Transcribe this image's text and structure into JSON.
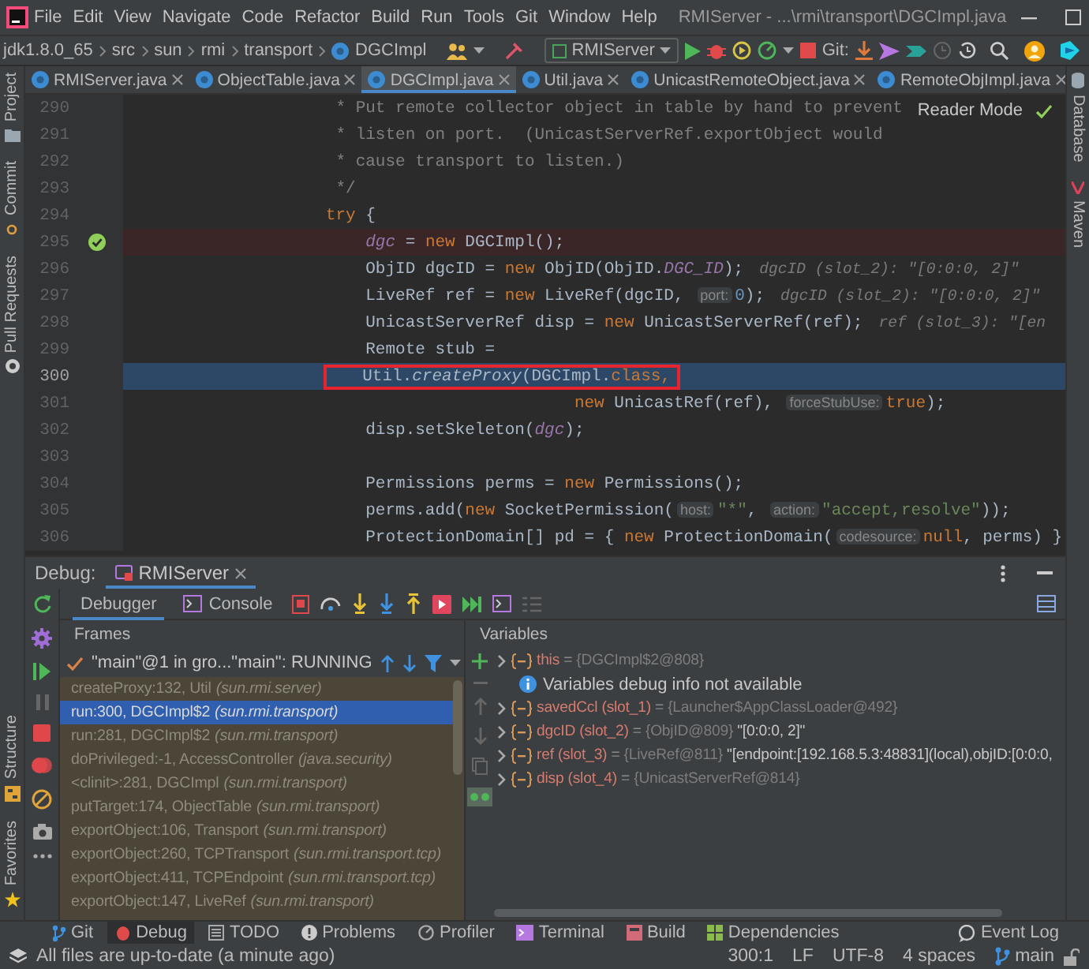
{
  "menu_bar": {
    "items": [
      "File",
      "Edit",
      "View",
      "Navigate",
      "Code",
      "Refactor",
      "Build",
      "Run",
      "Tools",
      "Git",
      "Window",
      "Help"
    ],
    "title": "RMIServer - ...\\rmi\\transport\\DGCImpl.java"
  },
  "nav_bar": {
    "breadcrumb": [
      "jdk1.8.0_65",
      "src",
      "sun",
      "rmi",
      "transport",
      "DGCImpl"
    ],
    "run_config": "RMIServer",
    "git_label": "Git:"
  },
  "editor_tabs": [
    {
      "label": "RMIServer.java",
      "selected": false
    },
    {
      "label": "ObjectTable.java",
      "selected": false
    },
    {
      "label": "DGCImpl.java",
      "selected": true
    },
    {
      "label": "Util.java",
      "selected": false
    },
    {
      "label": "UnicastRemoteObject.java",
      "selected": false
    },
    {
      "label": "RemoteObjImpl.java",
      "selected": false
    }
  ],
  "left_tool_strip": {
    "top": [
      "Project",
      "Commit",
      "Pull Requests"
    ],
    "bottom": [
      "Structure",
      "Favorites"
    ]
  },
  "right_tool_strip": [
    "Database",
    "Maven"
  ],
  "editor": {
    "reader_mode": "Reader Mode",
    "lines": [
      {
        "number": "290",
        "breakpoint": false,
        "current": false,
        "annotated": false,
        "tokens": [
          {
            "kind": "comment",
            "text": "         * Put remote collector object in table by hand to prevent"
          }
        ]
      },
      {
        "number": "291",
        "breakpoint": false,
        "current": false,
        "annotated": false,
        "tokens": [
          {
            "kind": "comment",
            "text": "         * listen on port.  (UnicastServerRef.exportObject would"
          }
        ]
      },
      {
        "number": "292",
        "breakpoint": false,
        "current": false,
        "annotated": false,
        "tokens": [
          {
            "kind": "comment",
            "text": "         * cause transport to listen.)"
          }
        ]
      },
      {
        "number": "293",
        "breakpoint": false,
        "current": false,
        "annotated": false,
        "tokens": [
          {
            "kind": "comment",
            "text": "         */"
          }
        ]
      },
      {
        "number": "294",
        "breakpoint": false,
        "current": false,
        "annotated": false,
        "tokens": [
          {
            "kind": "kw",
            "text": "        try"
          },
          {
            "kind": "plain",
            "text": " {"
          }
        ]
      },
      {
        "number": "295",
        "breakpoint": true,
        "current": false,
        "annotated": false,
        "tokens": [
          {
            "kind": "field",
            "text": "            dgc"
          },
          {
            "kind": "plain",
            "text": " = "
          },
          {
            "kind": "kw",
            "text": "new"
          },
          {
            "kind": "plain",
            "text": " DGCImpl();"
          }
        ]
      },
      {
        "number": "296",
        "breakpoint": false,
        "current": false,
        "annotated": false,
        "tokens": [
          {
            "kind": "plain",
            "text": "            ObjID dgcID = "
          },
          {
            "kind": "kw",
            "text": "new"
          },
          {
            "kind": "plain",
            "text": " ObjID(ObjID."
          },
          {
            "kind": "static",
            "text": "DGC_ID"
          },
          {
            "kind": "plain",
            "text": ");"
          },
          {
            "kind": "inline",
            "text": "dgcID (slot_2): \"[0:0:0, 2]\""
          }
        ]
      },
      {
        "number": "297",
        "breakpoint": false,
        "current": false,
        "annotated": false,
        "tokens": [
          {
            "kind": "plain",
            "text": "            LiveRef ref = "
          },
          {
            "kind": "kw",
            "text": "new"
          },
          {
            "kind": "plain",
            "text": " LiveRef(dgcID, "
          },
          {
            "kind": "hint",
            "text": "port:"
          },
          {
            "kind": "num",
            "text": "0"
          },
          {
            "kind": "plain",
            "text": ");"
          },
          {
            "kind": "inline",
            "text": "dgcID (slot_2): \"[0:0:0, 2]\""
          }
        ]
      },
      {
        "number": "298",
        "breakpoint": false,
        "current": false,
        "annotated": false,
        "tokens": [
          {
            "kind": "plain",
            "text": "            UnicastServerRef disp = "
          },
          {
            "kind": "kw",
            "text": "new"
          },
          {
            "kind": "plain",
            "text": " UnicastServerRef(ref);"
          },
          {
            "kind": "inline",
            "text": "ref (slot_3): \"[en"
          }
        ]
      },
      {
        "number": "299",
        "breakpoint": false,
        "current": false,
        "annotated": false,
        "tokens": [
          {
            "kind": "plain",
            "text": "            Remote stub ="
          }
        ]
      },
      {
        "number": "300",
        "breakpoint": false,
        "current": true,
        "annotated": true,
        "tokens": [
          {
            "kind": "plain",
            "text": "            Util."
          },
          {
            "kind": "method",
            "text": "createProxy"
          },
          {
            "kind": "plain",
            "text": "(DGCImpl."
          },
          {
            "kind": "kw",
            "text": "class,"
          }
        ]
      },
      {
        "number": "301",
        "breakpoint": false,
        "current": false,
        "annotated": false,
        "tokens": [
          {
            "kind": "kw",
            "text": "                                 new"
          },
          {
            "kind": "plain",
            "text": " UnicastRef(ref), "
          },
          {
            "kind": "hint",
            "text": "forceStubUse:"
          },
          {
            "kind": "kw",
            "text": "true"
          },
          {
            "kind": "plain",
            "text": ");"
          }
        ]
      },
      {
        "number": "302",
        "breakpoint": false,
        "current": false,
        "annotated": false,
        "tokens": [
          {
            "kind": "plain",
            "text": "            disp.setSkeleton("
          },
          {
            "kind": "field",
            "text": "dgc"
          },
          {
            "kind": "plain",
            "text": ");"
          }
        ]
      },
      {
        "number": "303",
        "breakpoint": false,
        "current": false,
        "annotated": false
      },
      {
        "number": "304",
        "breakpoint": false,
        "current": false,
        "annotated": false,
        "tokens": [
          {
            "kind": "plain",
            "text": "            Permissions perms = "
          },
          {
            "kind": "kw",
            "text": "new"
          },
          {
            "kind": "plain",
            "text": " Permissions();"
          }
        ]
      },
      {
        "number": "305",
        "breakpoint": false,
        "current": false,
        "annotated": false,
        "tokens": [
          {
            "kind": "plain",
            "text": "            perms.add("
          },
          {
            "kind": "kw",
            "text": "new"
          },
          {
            "kind": "plain",
            "text": " SocketPermission("
          },
          {
            "kind": "hint",
            "text": "host:"
          },
          {
            "kind": "str",
            "text": "\"*\""
          },
          {
            "kind": "plain",
            "text": ", "
          },
          {
            "kind": "hint",
            "text": "action:"
          },
          {
            "kind": "str",
            "text": "\"accept,resolve\""
          },
          {
            "kind": "plain",
            "text": "));"
          }
        ]
      },
      {
        "number": "306",
        "breakpoint": false,
        "current": false,
        "annotated": false,
        "tokens": [
          {
            "kind": "plain",
            "text": "            ProtectionDomain[] pd = { "
          },
          {
            "kind": "kw",
            "text": "new"
          },
          {
            "kind": "plain",
            "text": " ProtectionDomain("
          },
          {
            "kind": "hint",
            "text": "codesource:"
          },
          {
            "kind": "kw",
            "text": "null"
          },
          {
            "kind": "plain",
            "text": ", perms) }"
          }
        ]
      }
    ]
  },
  "debug": {
    "label": "Debug:",
    "session_tab": "RMIServer",
    "tabs": [
      {
        "label": "Debugger",
        "selected": true
      },
      {
        "label": "Console",
        "selected": false
      }
    ],
    "frames_title": "Frames",
    "variables_title": "Variables",
    "thread": "\"main\"@1 in gro...\"main\": RUNNING",
    "frames": [
      {
        "frame": "createProxy:132, Util",
        "package": "(sun.rmi.server)",
        "selected": false
      },
      {
        "frame": "run:300, DGCImpl$2",
        "package": "(sun.rmi.transport)",
        "selected": true
      },
      {
        "frame": "run:281, DGCImpl$2",
        "package": "(sun.rmi.transport)",
        "selected": false
      },
      {
        "frame": "doPrivileged:-1, AccessController",
        "package": "(java.security)",
        "selected": false
      },
      {
        "frame": "<clinit>:281, DGCImpl",
        "package": "(sun.rmi.transport)",
        "selected": false
      },
      {
        "frame": "putTarget:174, ObjectTable",
        "package": "(sun.rmi.transport)",
        "selected": false
      },
      {
        "frame": "exportObject:106, Transport",
        "package": "(sun.rmi.transport)",
        "selected": false
      },
      {
        "frame": "exportObject:260, TCPTransport",
        "package": "(sun.rmi.transport.tcp)",
        "selected": false
      },
      {
        "frame": "exportObject:411, TCPEndpoint",
        "package": "(sun.rmi.transport.tcp)",
        "selected": false
      },
      {
        "frame": "exportObject:147, LiveRef",
        "package": "(sun.rmi.transport)",
        "selected": false
      }
    ],
    "variables": [
      {
        "kind": "variable",
        "expanded": false,
        "name": "this",
        "operator": "=",
        "value": "{DGCImpl$2@808}"
      },
      {
        "kind": "info",
        "text": "Variables debug info not available"
      },
      {
        "kind": "variable",
        "expanded": false,
        "name": "savedCcl (slot_1)",
        "operator": "=",
        "value": "{Launcher$AppClassLoader@492}"
      },
      {
        "kind": "variable",
        "expanded": false,
        "name": "dgcID (slot_2)",
        "operator": "=",
        "value": "{ObjID@809}",
        "display": "\"[0:0:0, 2]\""
      },
      {
        "kind": "variable",
        "expanded": false,
        "name": "ref (slot_3)",
        "operator": "=",
        "value": "{LiveRef@811}",
        "display": "\"[endpoint:[192.168.5.3:48831](local),objID:[0:0:0,"
      },
      {
        "kind": "variable",
        "expanded": false,
        "name": "disp (slot_4)",
        "operator": "=",
        "value": "{UnicastServerRef@814}"
      }
    ]
  },
  "tool_window_tabs": [
    {
      "label": "Git",
      "selected": false
    },
    {
      "label": "Debug",
      "selected": true
    },
    {
      "label": "TODO",
      "selected": false
    },
    {
      "label": "Problems",
      "selected": false
    },
    {
      "label": "Profiler",
      "selected": false
    },
    {
      "label": "Terminal",
      "selected": false
    },
    {
      "label": "Build",
      "selected": false
    },
    {
      "label": "Dependencies",
      "selected": false
    }
  ],
  "event_log": "Event Log",
  "status_bar": {
    "message": "All files are up-to-date (a minute ago)",
    "position": "300:1",
    "line_separator": "LF",
    "encoding": "UTF-8",
    "indent": "4 spaces",
    "branch": "main"
  }
}
